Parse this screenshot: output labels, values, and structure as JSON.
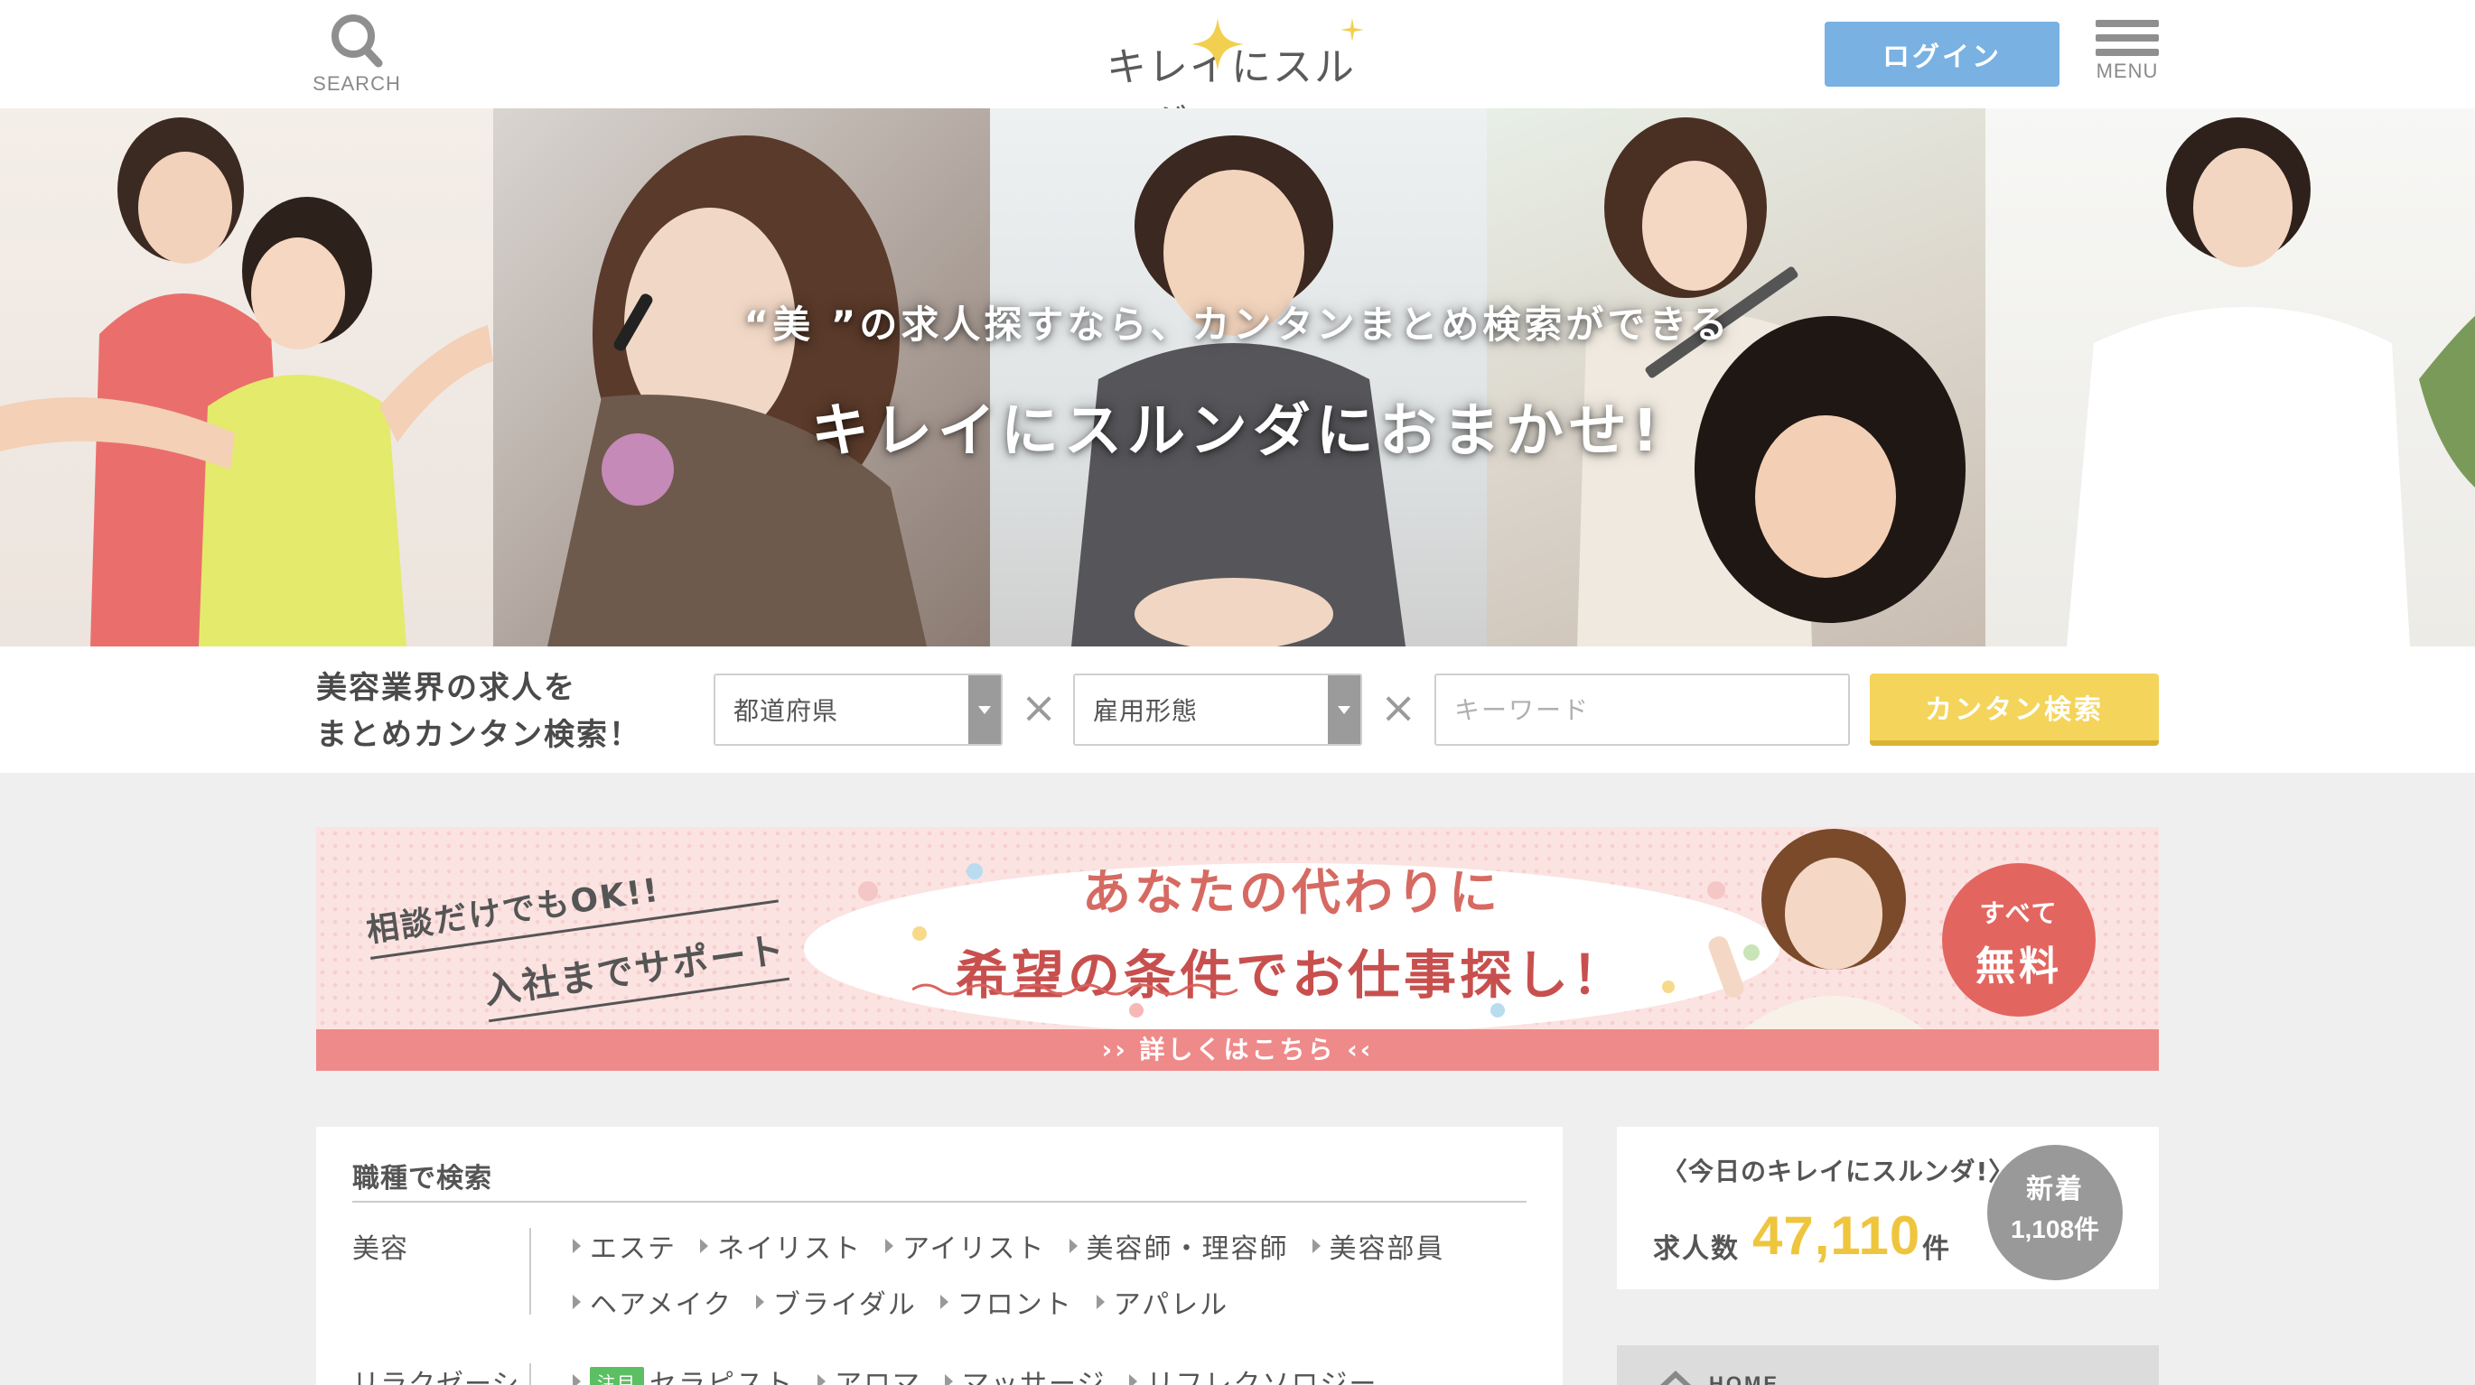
{
  "header": {
    "search_label": "SEARCH",
    "logo_text": "キレイにスルンダ",
    "login_label": "ログイン",
    "menu_label": "MENU"
  },
  "hero": {
    "subtitle": "“美 ”の求人探すなら、カンタンまとめ検索ができる",
    "title": "キレイにスルンダにおまかせ!"
  },
  "searchbar": {
    "lead_line1": "美容業界の求人を",
    "lead_line2": "まとめカンタン検索！",
    "prefecture_value": "都道府県",
    "employment_value": "雇用形態",
    "keyword_placeholder": "キーワード",
    "search_button": "カンタン検索",
    "separator": "×"
  },
  "banner": {
    "left_line1": "相談だけでもOK!!",
    "left_line2": "入社までサポート",
    "title_line1": "あなたの代わりに",
    "title_line2": "希望の条件でお仕事探し！",
    "badge_line1": "すべて",
    "badge_line2": "無料",
    "footer": "›› 詳しくはこちら ‹‹"
  },
  "job_search": {
    "title": "職種で検索",
    "categories": [
      {
        "label": "美容",
        "rows": [
          [
            "エステ",
            "ネイリスト",
            "アイリスト",
            "美容師・理容師",
            "美容部員"
          ],
          [
            "ヘアメイク",
            "ブライダル",
            "フロント",
            "アパレル"
          ]
        ]
      },
      {
        "label": "リラクゼーシ",
        "hot_badge": "注目",
        "rows": [
          [
            "セラピスト",
            "アロマ",
            "マッサージ",
            "リフレクソロジー"
          ]
        ]
      }
    ]
  },
  "counts": {
    "heading": "〈今日のキレイにスルンダ!〉",
    "jobs_label": "求人数",
    "jobs_value": "47,110",
    "jobs_unit": "件",
    "new_label": "新着",
    "new_value": "1,108件"
  },
  "home_nav": {
    "label": "HOME"
  },
  "colors": {
    "login_blue": "#78b1e2",
    "search_yellow": "#f4d45a",
    "count_yellow": "#eec53d",
    "banner_pink": "#ef8a8a",
    "badge_red": "#e3655f"
  }
}
